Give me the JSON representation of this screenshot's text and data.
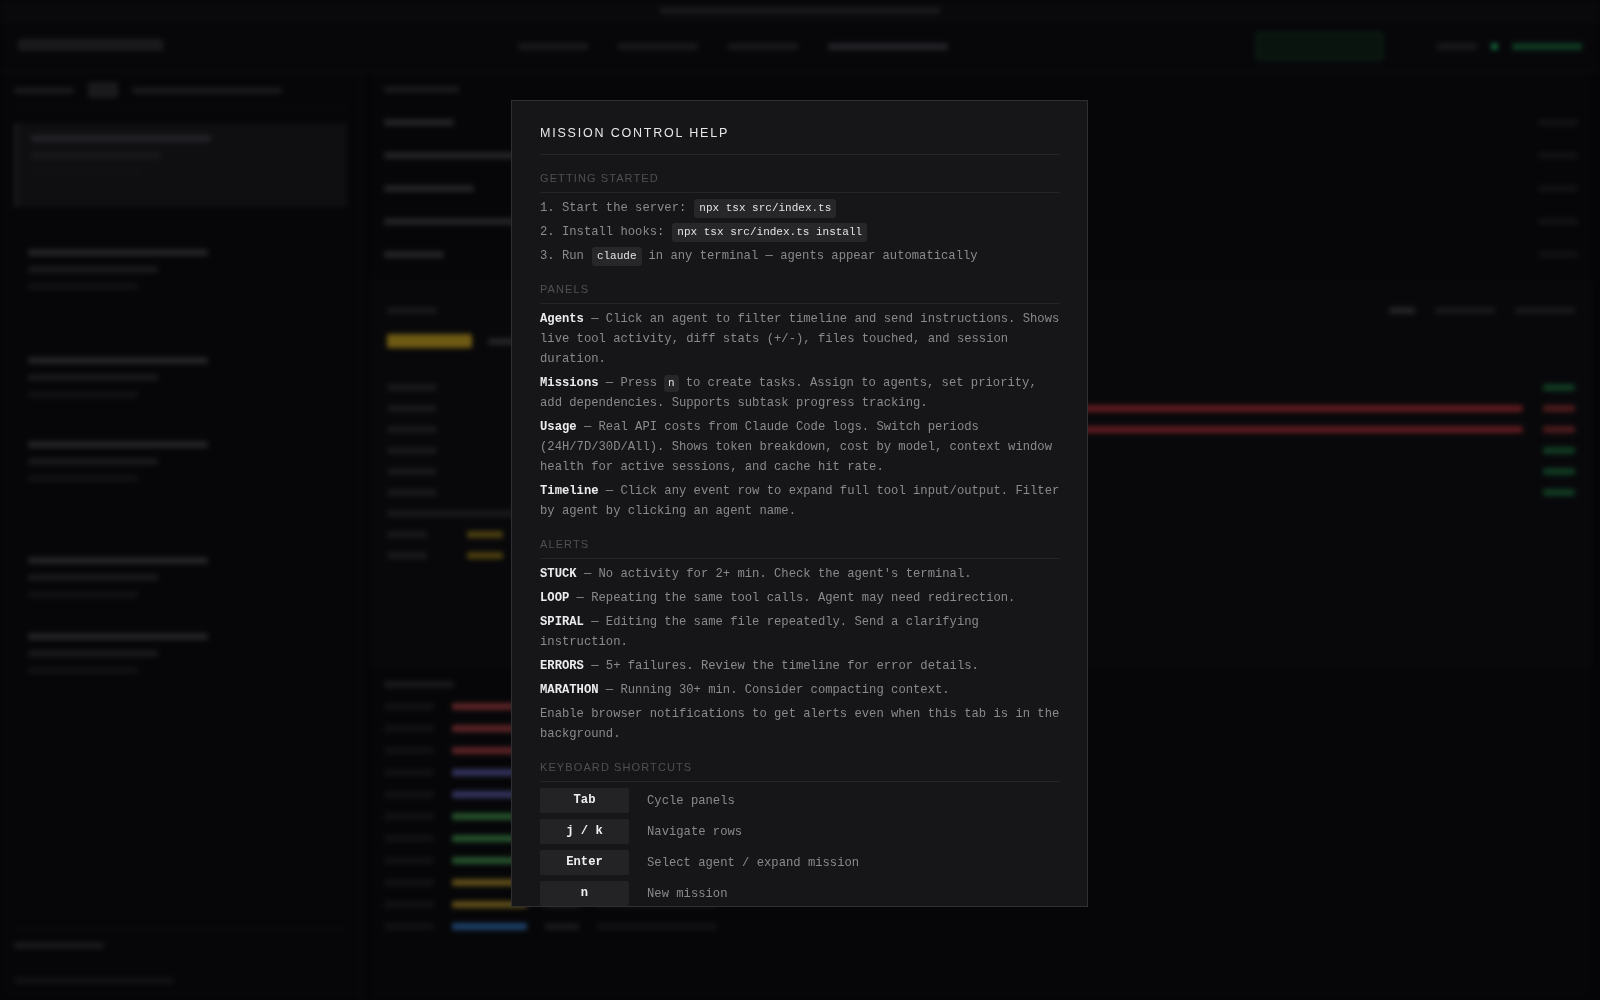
{
  "modal": {
    "title": "MISSION CONTROL HELP",
    "sections": [
      {
        "kind": "paragraphs",
        "heading": "GETTING STARTED",
        "items": [
          {
            "parts": [
              {
                "kind": "text",
                "text": "1. Start the server:"
              },
              {
                "kind": "code",
                "text": "npx tsx src/index.ts"
              }
            ]
          },
          {
            "parts": [
              {
                "kind": "text",
                "text": "2. Install hooks:"
              },
              {
                "kind": "code",
                "text": "npx tsx src/index.ts install"
              }
            ]
          },
          {
            "parts": [
              {
                "kind": "text",
                "text": "3. Run"
              },
              {
                "kind": "code",
                "text": "claude"
              },
              {
                "kind": "text",
                "text": "in any terminal — agents appear automatically"
              }
            ]
          }
        ]
      },
      {
        "kind": "paragraphs",
        "heading": "PANELS",
        "items": [
          {
            "parts": [
              {
                "kind": "text",
                "text": "**Agents** — Click an agent to filter timeline and send instructions. Shows live tool activity, diff stats (+/-), files touched, and session duration."
              }
            ]
          },
          {
            "parts": [
              {
                "kind": "text",
                "text": "**Missions** — Press"
              },
              {
                "kind": "key",
                "text": "n"
              },
              {
                "kind": "text",
                "text": "to create tasks. Assign to agents, set priority, add dependencies. Supports subtask progress tracking."
              }
            ]
          },
          {
            "parts": [
              {
                "kind": "text",
                "text": "**Usage** — Real API costs from Claude Code logs. Switch periods (24H/7D/30D/All). Shows token breakdown, cost by model, context window health for active sessions, and cache hit rate."
              }
            ]
          },
          {
            "parts": [
              {
                "kind": "text",
                "text": "**Timeline** — Click any event row to expand full tool input/output. Filter by agent by clicking an agent name."
              }
            ]
          }
        ]
      },
      {
        "kind": "paragraphs",
        "heading": "ALERTS",
        "items": [
          {
            "parts": [
              {
                "kind": "text",
                "text": "**STUCK** — No activity for 2+ min. Check the agent's terminal."
              }
            ]
          },
          {
            "parts": [
              {
                "kind": "text",
                "text": "**LOOP** — Repeating the same tool calls. Agent may need redirection."
              }
            ]
          },
          {
            "parts": [
              {
                "kind": "text",
                "text": "**SPIRAL** — Editing the same file repeatedly. Send a clarifying instruction."
              }
            ]
          },
          {
            "parts": [
              {
                "kind": "text",
                "text": "**ERRORS** — 5+ failures. Review the timeline for error details."
              }
            ]
          },
          {
            "parts": [
              {
                "kind": "text",
                "text": "**MARATHON** — Running 30+ min. Consider compacting context."
              }
            ]
          },
          {
            "parts": [
              {
                "kind": "text",
                "text": "Enable browser notifications to get alerts even when this tab is in the background."
              }
            ]
          }
        ]
      },
      {
        "kind": "shortcuts",
        "heading": "KEYBOARD SHORTCUTS",
        "items": [
          {
            "key": "Tab",
            "action": "Cycle panels"
          },
          {
            "key": "j / k",
            "action": "Navigate rows"
          },
          {
            "key": "Enter",
            "action": "Select agent / expand mission"
          },
          {
            "key": "n",
            "action": "New mission"
          }
        ]
      }
    ]
  }
}
